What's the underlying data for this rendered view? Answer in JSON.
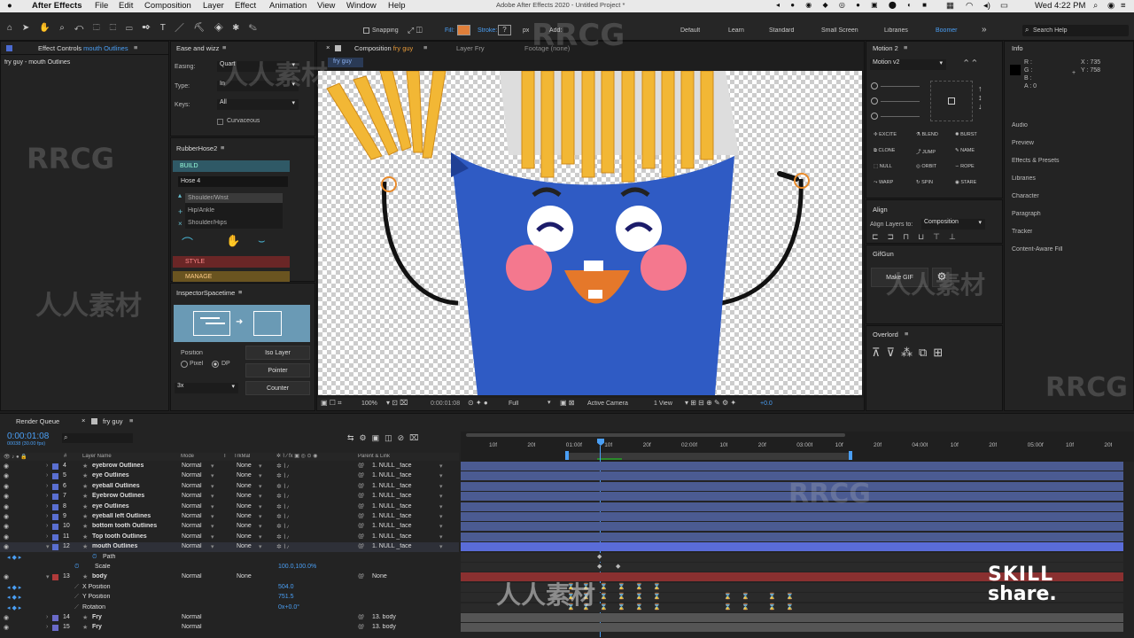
{
  "menubar": {
    "app": "After Effects",
    "items": [
      "File",
      "Edit",
      "Composition",
      "Layer",
      "Effect",
      "Animation",
      "View",
      "Window",
      "Help"
    ],
    "title": "Adobe After Effects 2020 - Untitled Project *",
    "clock": "Wed 4:22 PM"
  },
  "toolbar": {
    "snapping": "Snapping",
    "fill": "Fill:",
    "stroke": "Stroke:",
    "stroke_value": "?",
    "px": "px",
    "add": "Add:",
    "workspaces": [
      "Default",
      "Learn",
      "Standard",
      "Small Screen",
      "Libraries",
      "Boomer"
    ],
    "search": "Search Help"
  },
  "effect_controls": {
    "title": "Effect Controls",
    "target": "mouth Outlines",
    "layer_path": "fry guy - mouth Outlines"
  },
  "ease": {
    "title": "Ease and wizz",
    "easing_label": "Easing:",
    "easing": "Quart",
    "type_label": "Type:",
    "type": "In",
    "keys_label": "Keys:",
    "keys": "All",
    "curvaceous": "Curvaceous"
  },
  "rubberhose": {
    "title": "RubberHose2",
    "build": "BUILD",
    "hose": "Hose 4",
    "items": [
      "Shoulder/Wrist",
      "Hip/Ankle",
      "Shoulder/Hips"
    ],
    "style": "STYLE",
    "manage": "MANAGE"
  },
  "inspector": {
    "title": "InspectorSpacetime",
    "position": "Position",
    "pixel": "Pixel",
    "dp": "DP",
    "iso": "Iso Layer",
    "pointer": "Pointer",
    "counter": "Counter",
    "scale": "3x"
  },
  "composition": {
    "tab_label": "Composition",
    "comp_name": "fry guy",
    "layer_tab": "Layer Fry",
    "footage_tab": "Footage (none)",
    "breadcrumb": "fry guy",
    "zoom": "100%",
    "time": "0:00:01:08",
    "resolution": "Full",
    "camera": "Active Camera",
    "view": "1 View",
    "exposure": "+0.0"
  },
  "motion": {
    "title": "Motion 2",
    "version": "Motion v2",
    "buttons": [
      "EXCITE",
      "BLEND",
      "BURST",
      "CLONE",
      "JUMP",
      "NAME",
      "NULL",
      "ORBIT",
      "ROPE",
      "WARP",
      "SPIN",
      "STARE"
    ]
  },
  "align": {
    "title": "Align",
    "align_to_label": "Align Layers to:",
    "align_to": "Composition"
  },
  "gifgun": {
    "title": "GifGun",
    "make": "Make GIF"
  },
  "overlord": {
    "title": "Overlord"
  },
  "info": {
    "title": "Info",
    "r": "R :",
    "g": "G :",
    "b": "B :",
    "a": "A :  0",
    "x": "X : 735",
    "y": "Y : 758",
    "panels": [
      "Audio",
      "Preview",
      "Effects & Presets",
      "Libraries",
      "Character",
      "Paragraph",
      "Tracker",
      "Content-Aware Fill"
    ]
  },
  "timeline": {
    "tabs": [
      "Render Queue",
      "fry guy"
    ],
    "time": "0:00:01:08",
    "fps": "00038 (30.00 fps)",
    "headers": {
      "name": "Layer Name",
      "mode": "Mode",
      "t": "T",
      "trkmat": "TrkMat",
      "parent": "Parent & Link"
    },
    "ruler": [
      "10f",
      "20f",
      "01:00f",
      "10f",
      "20f",
      "02:00f",
      "10f",
      "20f",
      "03:00f",
      "10f",
      "20f",
      "04:00f",
      "10f",
      "20f",
      "05:00f",
      "10f",
      "20f"
    ],
    "layers": [
      {
        "num": "4",
        "name": "eyebrow Outlines",
        "mode": "Normal",
        "trk": "None",
        "parent": "1. NULL _face",
        "color": "#5a6fd0"
      },
      {
        "num": "5",
        "name": "eye Outlines",
        "mode": "Normal",
        "trk": "None",
        "parent": "1. NULL _face",
        "color": "#5a6fd0"
      },
      {
        "num": "6",
        "name": "eyeball Outlines",
        "mode": "Normal",
        "trk": "None",
        "parent": "1. NULL _face",
        "color": "#5a6fd0"
      },
      {
        "num": "7",
        "name": "Eyebrow Outlines",
        "mode": "Normal",
        "trk": "None",
        "parent": "1. NULL _face",
        "color": "#5a6fd0"
      },
      {
        "num": "8",
        "name": "eye Outlines",
        "mode": "Normal",
        "trk": "None",
        "parent": "1. NULL _face",
        "color": "#5a6fd0"
      },
      {
        "num": "9",
        "name": "eyeball left Outlines",
        "mode": "Normal",
        "trk": "None",
        "parent": "1. NULL _face",
        "color": "#5a6fd0"
      },
      {
        "num": "10",
        "name": "bottom tooth Outlines",
        "mode": "Normal",
        "trk": "None",
        "parent": "1. NULL _face",
        "color": "#5a6fd0"
      },
      {
        "num": "11",
        "name": "Top tooth Outlines",
        "mode": "Normal",
        "trk": "None",
        "parent": "1. NULL _face",
        "color": "#5a6fd0"
      },
      {
        "num": "12",
        "name": "mouth Outlines",
        "mode": "Normal",
        "trk": "None",
        "parent": "1. NULL _face",
        "color": "#5a6fd0"
      }
    ],
    "sub_path": "Path",
    "sub_scale": "Scale",
    "scale_val": "100.0,100.0%",
    "body": {
      "num": "13",
      "name": "body",
      "mode": "Normal",
      "trk": "None",
      "parent": "None"
    },
    "body_props": [
      {
        "name": "X Position",
        "value": "504.0"
      },
      {
        "name": "Y Position",
        "value": "751.5"
      },
      {
        "name": "Rotation",
        "value": "0x+0.0°"
      }
    ],
    "fry_layers": [
      {
        "num": "14",
        "name": "Fry",
        "mode": "Normal",
        "parent": "13. body"
      },
      {
        "num": "15",
        "name": "Fry",
        "mode": "Normal",
        "parent": "13. body"
      }
    ]
  },
  "watermarks": {
    "brand": "RRCG",
    "cn": "人人素材",
    "skill": "SKILL",
    "share": "share."
  }
}
